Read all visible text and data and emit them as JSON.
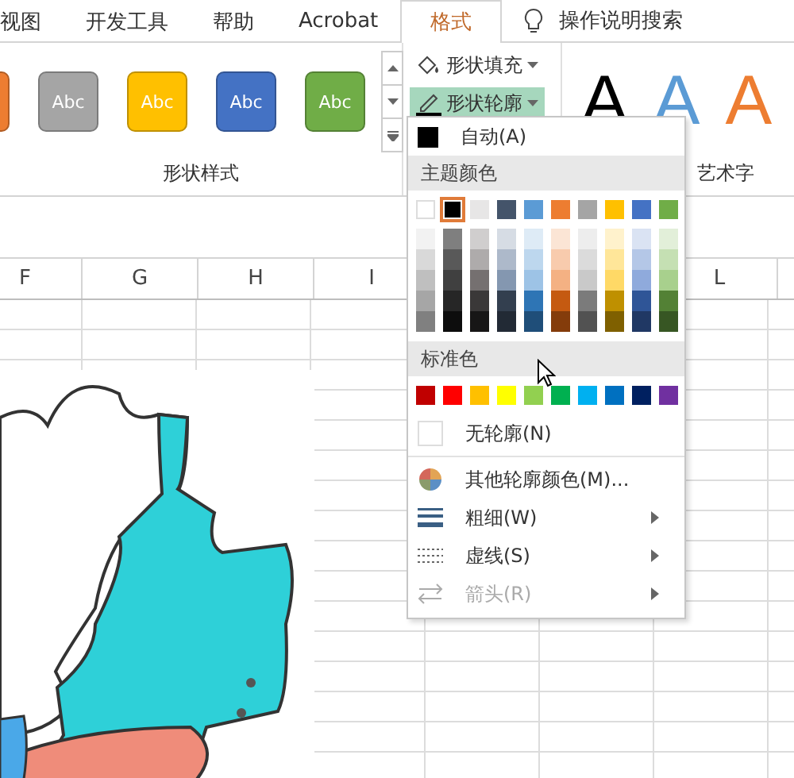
{
  "ribbon_tabs": [
    {
      "label": "视图",
      "selected": false
    },
    {
      "label": "开发工具",
      "selected": false
    },
    {
      "label": "帮助",
      "selected": false
    },
    {
      "label": "Acrobat",
      "selected": false
    },
    {
      "label": "格式",
      "selected": true
    }
  ],
  "tell_me": "操作说明搜索",
  "shape_styles": [
    {
      "color": "#ed7d31"
    },
    {
      "label": "Abc",
      "color": "#a5a5a5"
    },
    {
      "label": "Abc",
      "color": "#ffc000"
    },
    {
      "label": "Abc",
      "color": "#4472c4"
    },
    {
      "label": "Abc",
      "color": "#70ad47"
    }
  ],
  "shape_fill_button": "形状填充",
  "shape_outline_button": {
    "label": "形状轮廓",
    "selected": true
  },
  "wordart": [
    {
      "label": "A",
      "color": "#000000"
    },
    {
      "label": "A",
      "color": "#5b9bd5"
    },
    {
      "label": "A",
      "color": "#ed7d31"
    }
  ],
  "group_labels": [
    "形状样式",
    "艺术字"
  ],
  "columns_left": [
    "F",
    "G",
    "H",
    "I"
  ],
  "columns_right": [
    "L"
  ],
  "outline_menu": {
    "automatic": "自动(A)",
    "theme_header": "主题颜色",
    "theme_colors": [
      {
        "color": "#ffffff",
        "selected": false
      },
      {
        "color": "#000000",
        "selected": true
      },
      {
        "color": "#e7e6e6",
        "selected": false
      },
      {
        "color": "#44546a",
        "selected": false
      },
      {
        "color": "#5b9bd5",
        "selected": false
      },
      {
        "color": "#ed7d31",
        "selected": false
      },
      {
        "color": "#a5a5a5",
        "selected": false
      },
      {
        "color": "#ffc000",
        "selected": false
      },
      {
        "color": "#4472c4",
        "selected": false
      },
      {
        "color": "#70ad47",
        "selected": false
      }
    ],
    "shades": [
      [
        {
          "color": "#f2f2f2"
        },
        {
          "color": "#d9d9d9"
        },
        {
          "color": "#bfbfbf"
        },
        {
          "color": "#a6a6a6"
        },
        {
          "color": "#808080"
        }
      ],
      [
        {
          "color": "#7f7f7f"
        },
        {
          "color": "#595959"
        },
        {
          "color": "#404040"
        },
        {
          "color": "#262626"
        },
        {
          "color": "#0d0d0d"
        }
      ],
      [
        {
          "color": "#d0cece"
        },
        {
          "color": "#aeabab"
        },
        {
          "color": "#757070"
        },
        {
          "color": "#3a3838"
        },
        {
          "color": "#171616"
        }
      ],
      [
        {
          "color": "#d6dce4"
        },
        {
          "color": "#adb9ca"
        },
        {
          "color": "#8497b0"
        },
        {
          "color": "#333f4f"
        },
        {
          "color": "#222a35"
        }
      ],
      [
        {
          "color": "#deebf6"
        },
        {
          "color": "#bdd7ee"
        },
        {
          "color": "#9dc3e6"
        },
        {
          "color": "#2e75b5"
        },
        {
          "color": "#1f4e79"
        }
      ],
      [
        {
          "color": "#fbe5d5"
        },
        {
          "color": "#f8cbad"
        },
        {
          "color": "#f4b183"
        },
        {
          "color": "#c55a11"
        },
        {
          "color": "#843c0b"
        }
      ],
      [
        {
          "color": "#ededed"
        },
        {
          "color": "#dbdbdb"
        },
        {
          "color": "#c9c9c9"
        },
        {
          "color": "#7b7b7b"
        },
        {
          "color": "#525252"
        }
      ],
      [
        {
          "color": "#fff2cc"
        },
        {
          "color": "#ffe699"
        },
        {
          "color": "#ffd966"
        },
        {
          "color": "#bf9000"
        },
        {
          "color": "#7f6000"
        }
      ],
      [
        {
          "color": "#dae3f3"
        },
        {
          "color": "#b4c7e7"
        },
        {
          "color": "#8faadc"
        },
        {
          "color": "#2f5597"
        },
        {
          "color": "#203864"
        }
      ],
      [
        {
          "color": "#e2efd9"
        },
        {
          "color": "#c5e0b3"
        },
        {
          "color": "#a8d08d"
        },
        {
          "color": "#538135"
        },
        {
          "color": "#375623"
        }
      ]
    ],
    "standard_header": "标准色",
    "standard_colors": [
      {
        "color": "#c00000"
      },
      {
        "color": "#ff0000"
      },
      {
        "color": "#ffc000"
      },
      {
        "color": "#ffff00"
      },
      {
        "color": "#92d050"
      },
      {
        "color": "#00b050"
      },
      {
        "color": "#00b0f0"
      },
      {
        "color": "#0070c0"
      },
      {
        "color": "#002060"
      },
      {
        "color": "#7030a0"
      }
    ],
    "no_outline": "无轮廓(N)",
    "items": [
      {
        "label": "其他轮廓颜色(M)...",
        "kind": "palette",
        "submenu": false,
        "disabled": false
      },
      {
        "label": "粗细(W)",
        "kind": "weight",
        "submenu": true,
        "disabled": false
      },
      {
        "label": "虚线(S)",
        "kind": "dash",
        "submenu": true,
        "disabled": false
      },
      {
        "label": "箭头(R)",
        "kind": "arrow",
        "submenu": true,
        "disabled": true
      }
    ]
  }
}
